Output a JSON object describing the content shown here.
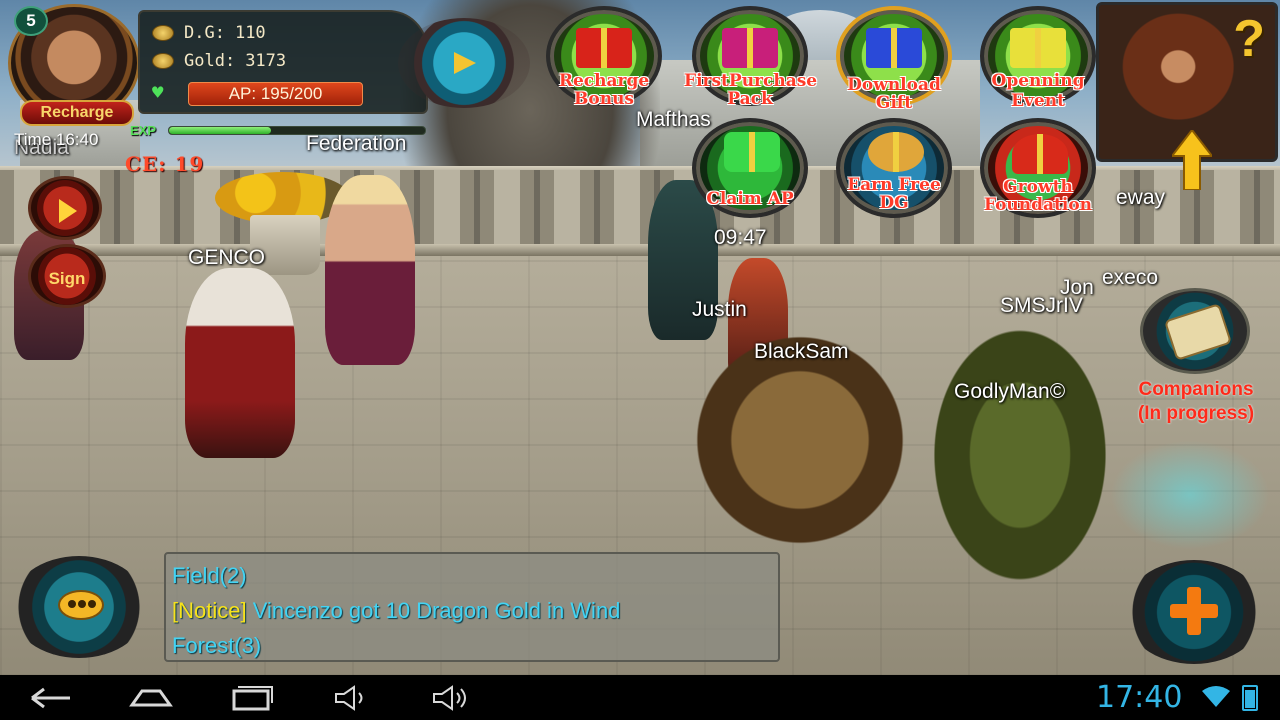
{
  "player": {
    "level": "5",
    "recharge_label": "Recharge",
    "dg_label": "D.G:",
    "dg_value": "110",
    "gold_label": "Gold:",
    "gold_value": "3173",
    "ap_text": "AP: 195/200",
    "exp_label": "EXP",
    "exp_progress": 0.4,
    "time_text": "Time 16:40",
    "ce_text": "CE: 19"
  },
  "left_buttons": {
    "sign_label": "Sign"
  },
  "events": [
    {
      "line1": "Recharge",
      "line2": "Bonus"
    },
    {
      "line1": "FirstPurchase",
      "line2": "Pack"
    },
    {
      "line1": "Download",
      "line2": "Gift"
    },
    {
      "line1": "Openning",
      "line2": "Event"
    },
    {
      "line1": "Claim AP",
      "line2": ""
    },
    {
      "line1": "Earn Free",
      "line2": "DG"
    },
    {
      "line1": "Growth",
      "line2": "Foundation"
    }
  ],
  "scene": {
    "names": [
      "Federation",
      "Mafthas",
      "GENCO",
      "Nadia",
      "09:47",
      "Justin",
      "BlackSam",
      "GodlyMan©",
      "SMSJrIV",
      "execo",
      "Jon",
      "eway"
    ]
  },
  "companions": {
    "line1": "Companions",
    "line2": "(In progress)"
  },
  "chat": {
    "line1": "Field(2)",
    "notice_tag": "[Notice]",
    "notice_text": " Vincenzo got 10 Dragon Gold in Wind",
    "line3": "Forest(3)"
  },
  "status_bar": {
    "clock": "17:40"
  },
  "colors": {
    "accent_red": "#ff3b2a",
    "chat_cyan": "#43d3f3",
    "notice_yellow": "#f7e21c",
    "clock_blue": "#33b5e5"
  },
  "icons": [
    "back-icon",
    "home-icon",
    "recent-apps-icon",
    "volume-down-icon",
    "volume-up-icon",
    "wifi-icon",
    "battery-icon"
  ]
}
